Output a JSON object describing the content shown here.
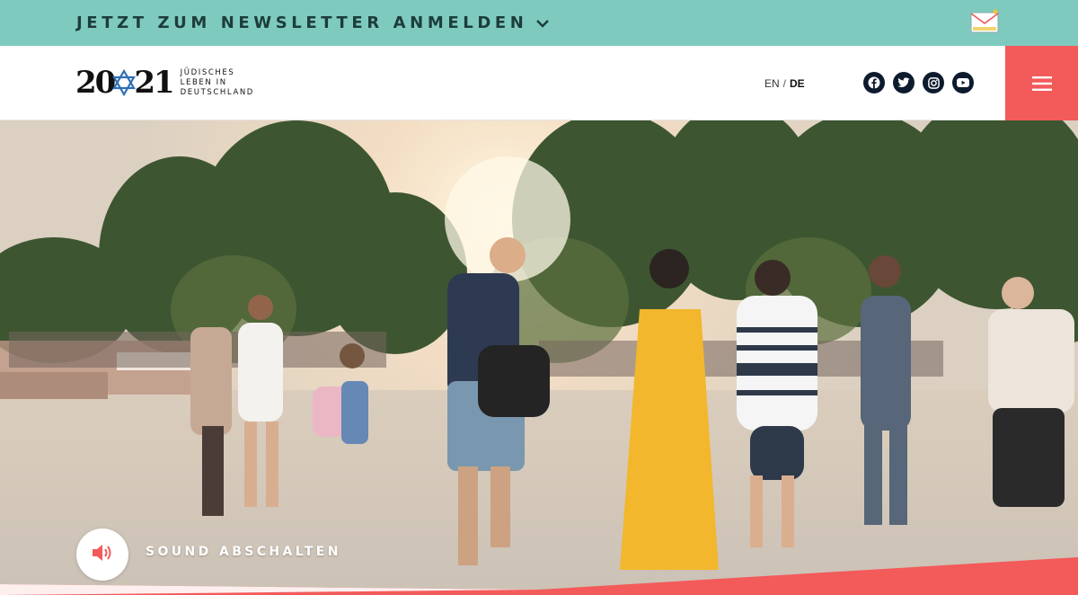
{
  "newsletter": {
    "label": "JETZT ZUM NEWSLETTER ANMELDEN",
    "chevron_icon": "chevron-down-icon",
    "mail_icon": "envelope-icon"
  },
  "logo": {
    "year_left": "20",
    "year_right": "21",
    "star_icon": "star-of-david-icon",
    "tagline_1": "JÜDISCHES",
    "tagline_2": "LEBEN IN",
    "tagline_3": "DEUTSCHLAND"
  },
  "languages": {
    "en": "EN",
    "separator": "/",
    "de": "DE",
    "active": "DE"
  },
  "socials": [
    {
      "name": "facebook-icon"
    },
    {
      "name": "twitter-icon"
    },
    {
      "name": "instagram-icon"
    },
    {
      "name": "youtube-icon"
    }
  ],
  "menu": {
    "icon": "hamburger-menu-icon"
  },
  "video": {
    "sound_label": "SOUND ABSCHALTEN",
    "sound_icon": "speaker-icon"
  },
  "colors": {
    "teal": "#7ecabf",
    "coral": "#f35a5a",
    "navy": "#0e1b2e",
    "gold_dress": "#f2b21c"
  }
}
